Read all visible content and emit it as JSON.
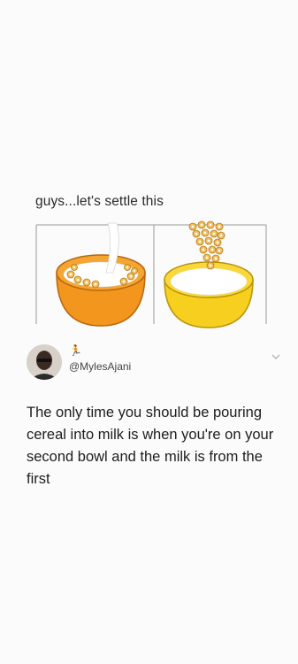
{
  "post": {
    "caption": "guys...let's settle this",
    "author": {
      "handle_emoji": "🏃",
      "handle": "@MylesAjani"
    },
    "text": "The only time you should be pouring cereal into milk is when you're on your second bowl and the milk is from the first"
  },
  "colors": {
    "bowl_left": "#f2961e",
    "bowl_right": "#f7cf1f",
    "milk": "#ffffff",
    "cereal": "#f3bd59"
  }
}
